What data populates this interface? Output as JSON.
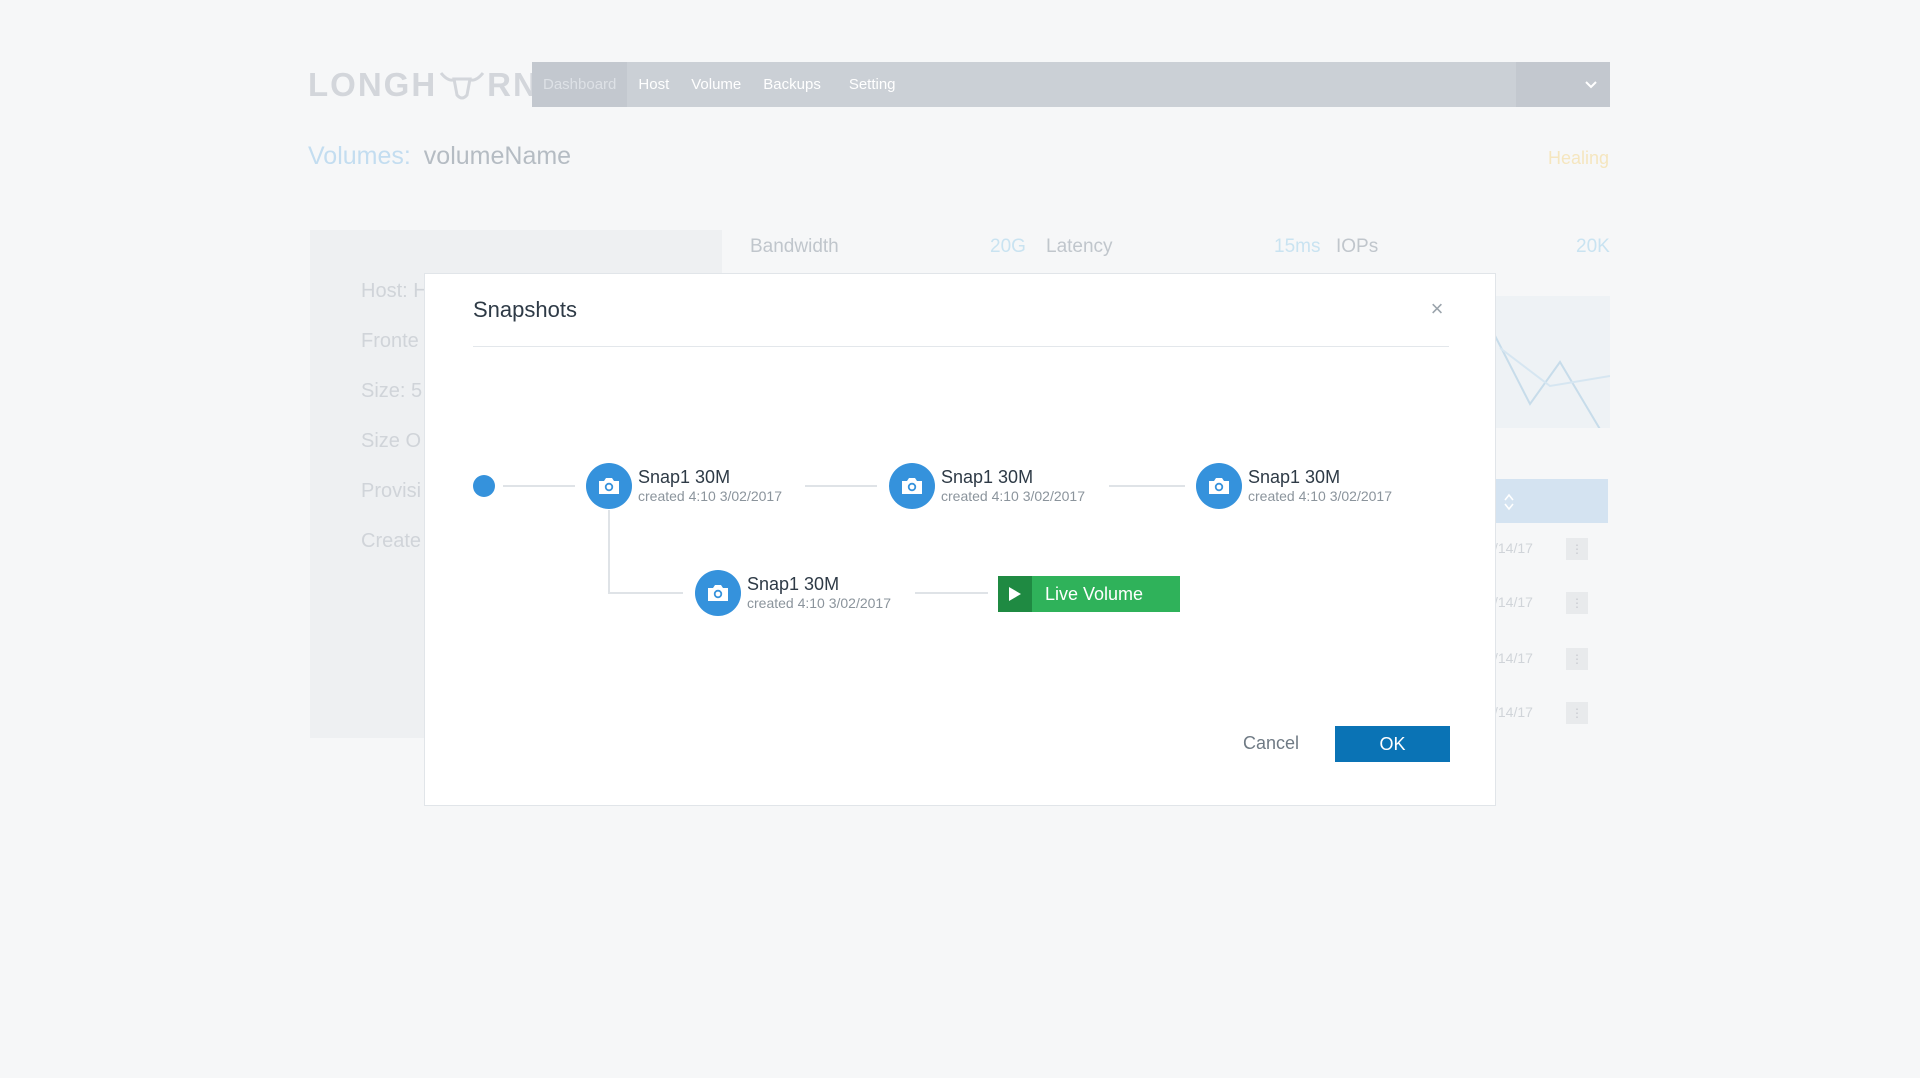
{
  "app": {
    "logo_text_left": "LONGH",
    "logo_text_right": "RN",
    "nav": [
      "Dashboard",
      "Host",
      "Volume",
      "Backups",
      "Setting"
    ],
    "active_nav": "Dashboard",
    "heading_label": "Volumes:",
    "heading_name": "volumeName",
    "status": "Healing",
    "info_labels": [
      "Host: H",
      "Fronte",
      "Size: 5",
      "Size O",
      "Provisi",
      "Create"
    ],
    "stats": {
      "bandwidth_label": "Bandwidth",
      "bandwidth_value": "20G",
      "latency_label": "Latency",
      "latency_value": "15ms",
      "iops_label": "IOPs",
      "iops_value": "20K"
    },
    "table_dates": [
      "/14/17",
      "/14/17",
      "/14/17",
      "/14/17"
    ],
    "row_menu_glyph": "⋮"
  },
  "modal": {
    "title": "Snapshots",
    "close_glyph": "×",
    "snapshots": [
      {
        "title": "Snap1 30M",
        "created": "created 4:10 3/02/2017"
      },
      {
        "title": "Snap1 30M",
        "created": "created 4:10 3/02/2017"
      },
      {
        "title": "Snap1 30M",
        "created": "created 4:10 3/02/2017"
      },
      {
        "title": "Snap1 30M",
        "created": "created 4:10 3/02/2017"
      }
    ],
    "live_volume_label": "Live Volume",
    "cancel_label": "Cancel",
    "ok_label": "OK"
  },
  "colors": {
    "accent": "#3592dc",
    "ok_button": "#0a73b5",
    "live_volume": "#2fb25a",
    "live_volume_dark": "#1f8a42"
  },
  "icons": [
    "camera-icon",
    "play-icon",
    "close-icon",
    "chevron-down-icon",
    "kebab-menu-icon",
    "sort-icon",
    "bull-horn-logo"
  ]
}
